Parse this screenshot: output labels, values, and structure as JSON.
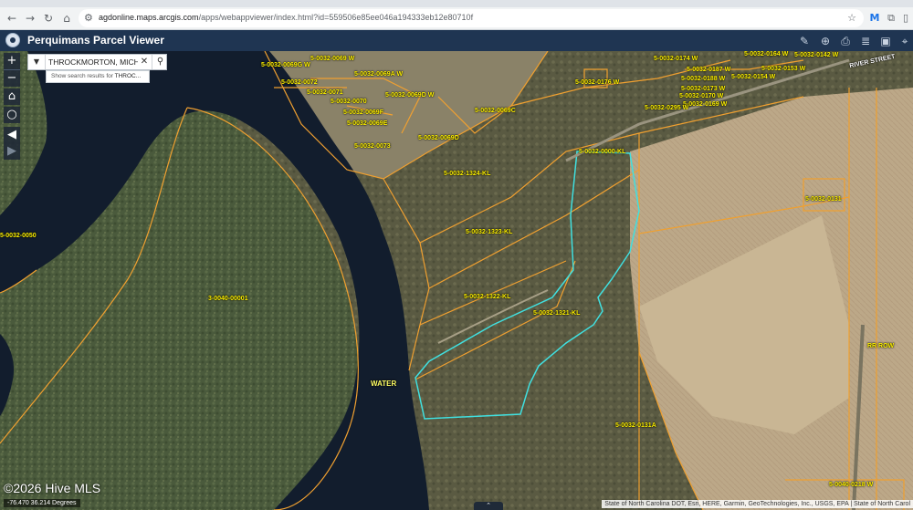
{
  "browser": {
    "url_host": "agdonline.maps.arcgis.com",
    "url_path": "/apps/webappviewer/index.html?id=559506e85ee046a194333eb12e80710f"
  },
  "app": {
    "title": "Perquimans Parcel Viewer"
  },
  "search": {
    "value": "THROCKMORTON, MICHA",
    "suggestion_prefix": "Show search results for ",
    "suggestion_term": "THROC..."
  },
  "map": {
    "labels": [
      {
        "text": "5-0032-0069 W"
      },
      {
        "text": "5-0032-0069G W"
      },
      {
        "text": "5-0032-0069A W"
      },
      {
        "text": "5-0032-0072"
      },
      {
        "text": "5-0032-0071"
      },
      {
        "text": "5-0032-0070"
      },
      {
        "text": "5-0032-0069D W"
      },
      {
        "text": "5-0032-0069F"
      },
      {
        "text": "5-0032-0069E"
      },
      {
        "text": "5-0032-0069C"
      },
      {
        "text": "5-0032-0073"
      },
      {
        "text": "5-0032-0069D"
      },
      {
        "text": "5-0032-0176 W"
      },
      {
        "text": "5-0032-0174 W"
      },
      {
        "text": "5-0032-0187 W"
      },
      {
        "text": "5-0032-0164 W"
      },
      {
        "text": "5-0032-0142 W"
      },
      {
        "text": "5-0032-0153 W"
      },
      {
        "text": "5-0032-0154 W"
      },
      {
        "text": "5-0032-0188 W"
      },
      {
        "text": "5-0032-0173 W"
      },
      {
        "text": "5-0032-0170 W"
      },
      {
        "text": "5-0032-0169 W"
      },
      {
        "text": "5-0032-0295 W"
      },
      {
        "text": "5-0032-0000-KL"
      },
      {
        "text": "5-0032-1324-KL"
      },
      {
        "text": "5-0032-1323-KL"
      },
      {
        "text": "5-0032-1322-KL"
      },
      {
        "text": "5-0032-1321-KL"
      },
      {
        "text": "5-0032-0131"
      },
      {
        "text": "3-0040-00001"
      },
      {
        "text": "5-0032-0050"
      },
      {
        "text": "WATER"
      },
      {
        "text": "5-0032-0131A"
      },
      {
        "text": "RR ROW"
      },
      {
        "text": "5-0040-0218 W"
      },
      {
        "text": "RIVER STREET"
      }
    ]
  },
  "footer": {
    "watermark": "©2026 Hive MLS",
    "coords": "-76.470 36.214 Degrees",
    "attribution": "State of North Carolina DOT, Esri, HERE, Garmin, GeoTechnologies, Inc., USGS, EPA | State of North Carol"
  },
  "colors": {
    "parcel_line": "#f0a030",
    "selected_parcel": "#40e0e0",
    "label": "#fff200",
    "header": "#1f3552"
  }
}
